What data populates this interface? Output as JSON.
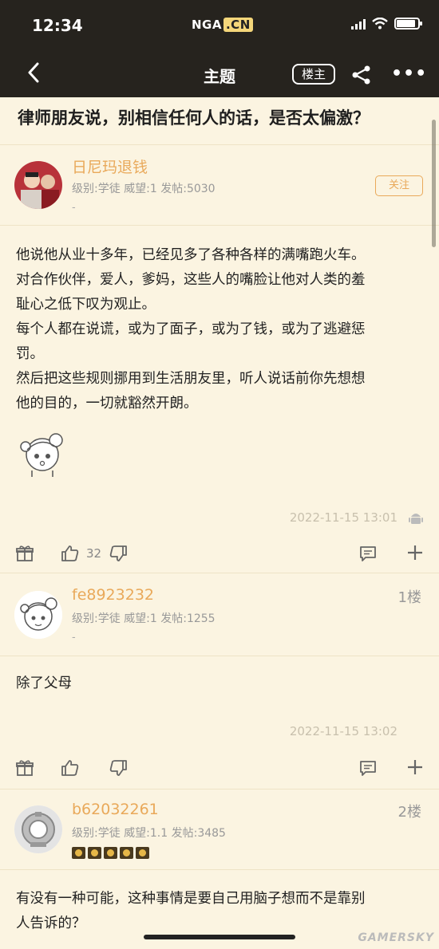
{
  "status_bar": {
    "time": "12:34",
    "brand_main": "NGA",
    "brand_cn": ".CN"
  },
  "nav": {
    "title": "主题",
    "op_label": "楼主"
  },
  "topic": {
    "title": "律师朋友说，别相信任何人的话，是否太偏激？"
  },
  "posts": [
    {
      "username": "日尼玛退钱",
      "meta": "级别:学徒  威望:1  发帖:5030",
      "dash": "-",
      "follow_label": "关注",
      "content": [
        "他说他从业十多年，已经见多了各种各样的满嘴跑火车。",
        "对合作伙伴，爱人，爹妈，这些人的嘴脸让他对人类的羞",
        "耻心之低下叹为观止。",
        "每个人都在说谎，或为了面子，或为了钱，或为了逃避惩",
        "罚。",
        "然后把这些规则挪用到生活朋友里，听人说话前你先想想",
        "他的目的，一切就豁然开朗。"
      ],
      "timestamp": "2022-11-15 13:01",
      "likes": "32"
    },
    {
      "username": "fe8923232",
      "floor": "1楼",
      "meta": "级别:学徒  威望:1  发帖:1255",
      "dash": "-",
      "content": [
        "除了父母"
      ],
      "timestamp": "2022-11-15 13:02"
    },
    {
      "username": "b62032261",
      "floor": "2楼",
      "meta": "级别:学徒  威望:1.1  发帖:3485",
      "content": [
        "有没有一种可能，这种事情是要自己用脑子想而不是靠别",
        "人告诉的？"
      ]
    }
  ],
  "watermark": "GAMERSKY",
  "colors": {
    "username": "#e9a95a",
    "bar_bg": "#26231e",
    "page_bg": "#fbf4e1"
  },
  "icons": [
    "back-icon",
    "share-icon",
    "more-icon",
    "gift-icon",
    "thumb-up-icon",
    "thumb-down-icon",
    "comment-icon",
    "plus-icon",
    "android-icon"
  ]
}
